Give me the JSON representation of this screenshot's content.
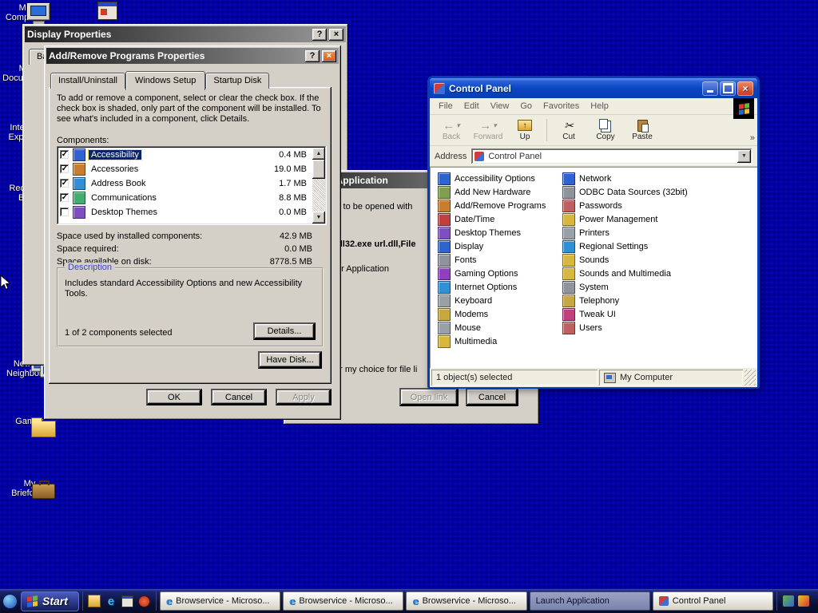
{
  "colors": {
    "desktop": "#0000a4",
    "window_gray": "#d4d0c8",
    "classic_titlebar_start": "#232323",
    "classic_titlebar_end": "#9a9a9a",
    "xp_titlebar_blue": "#0a46c4",
    "close_button_orange": "#d4541c",
    "selection_navy": "#0a246a",
    "taskbar_navy": "#0c1238"
  },
  "desktop": {
    "icons": [
      {
        "label": "My Computer"
      },
      {
        "label": ""
      },
      {
        "label": "My Documents"
      },
      {
        "label": "Internet Explorer"
      },
      {
        "label": "Recycle Bin"
      },
      {
        "label": ""
      },
      {
        "label": ""
      },
      {
        "label": "Network Neighborhood"
      },
      {
        "label": "Games"
      },
      {
        "label": "My Briefcase"
      }
    ]
  },
  "display_properties": {
    "title": "Display Properties",
    "help_button": "?",
    "close_button": "×",
    "background_tab": "Background"
  },
  "add_remove": {
    "title": "Add/Remove Programs Properties",
    "help_button": "?",
    "close_button": "×",
    "tabs": [
      {
        "label": "Install/Uninstall"
      },
      {
        "label": "Windows Setup"
      },
      {
        "label": "Startup Disk"
      }
    ],
    "intro": "To add or remove a component, select or clear the check box. If the check box is shaded, only part of the component will be installed. To see what's included in a component, click Details.",
    "components_label": "Components:",
    "components": [
      {
        "name": "Accessibility",
        "size": "0.4 MB",
        "color": "#2f63cf"
      },
      {
        "name": "Accessories",
        "size": "19.0 MB",
        "color": "#c77f2f"
      },
      {
        "name": "Address Book",
        "size": "1.7 MB",
        "color": "#2f8fd7"
      },
      {
        "name": "Communications",
        "size": "8.8 MB",
        "color": "#3fae6f"
      },
      {
        "name": "Desktop Themes",
        "size": "0.0 MB",
        "color": "#7f4fc2"
      }
    ],
    "space": [
      {
        "label": "Space used by installed components:",
        "value": "42.9 MB"
      },
      {
        "label": "Space required:",
        "value": "0.0 MB"
      },
      {
        "label": "Space available on disk:",
        "value": "8778.5 MB"
      }
    ],
    "description_title": "Description",
    "description_text": "Includes standard Accessibility Options and new Accessibility Tools.",
    "selection_summary": "1 of 2 components selected",
    "details_button": "Details...",
    "have_disk_button": "Have Disk...",
    "ok_button": "OK",
    "cancel_button": "Cancel",
    "apply_button": "Apply"
  },
  "launch_dialog": {
    "title": "Launch Application",
    "fragment_line1": "s to be opened with",
    "fragment_command": "dll32.exe url.dll,File",
    "fragment_line2": "er Application",
    "fragment_line3": "er my choice for file li",
    "open_link_button": "Open link",
    "cancel_button": "Cancel"
  },
  "control_panel": {
    "title": "Control Panel",
    "menu": [
      {
        "label": "File"
      },
      {
        "label": "Edit"
      },
      {
        "label": "View"
      },
      {
        "label": "Go"
      },
      {
        "label": "Favorites"
      },
      {
        "label": "Help"
      }
    ],
    "toolbar": [
      {
        "label": "Back"
      },
      {
        "label": "Forward"
      },
      {
        "label": "Up"
      },
      {
        "label": "Cut"
      },
      {
        "label": "Copy"
      },
      {
        "label": "Paste"
      }
    ],
    "address_label": "Address",
    "address_value": "Control Panel",
    "items_col1": [
      {
        "label": "Accessibility Options",
        "color": "#2f63cf"
      },
      {
        "label": "Add New Hardware",
        "color": "#7f9f4f"
      },
      {
        "label": "Add/Remove Programs",
        "color": "#c77f2f"
      },
      {
        "label": "Date/Time",
        "color": "#c23f3f"
      },
      {
        "label": "Desktop Themes",
        "color": "#7f4fc2"
      },
      {
        "label": "Display",
        "color": "#2f63cf"
      },
      {
        "label": "Fonts",
        "color": "#8f939b"
      },
      {
        "label": "Gaming Options",
        "color": "#8f3fbf"
      },
      {
        "label": "Internet Options",
        "color": "#2f8fd7"
      },
      {
        "label": "Keyboard",
        "color": "#9aa0a8"
      },
      {
        "label": "Modems",
        "color": "#c7a73f"
      },
      {
        "label": "Mouse",
        "color": "#9aa0a8"
      },
      {
        "label": "Multimedia",
        "color": "#d7b73f"
      }
    ],
    "items_col2": [
      {
        "label": "Network",
        "color": "#2f63cf"
      },
      {
        "label": "ODBC Data Sources (32bit)",
        "color": "#8f939b"
      },
      {
        "label": "Passwords",
        "color": "#bf5f5f"
      },
      {
        "label": "Power Management",
        "color": "#d7b73f"
      },
      {
        "label": "Printers",
        "color": "#9aa0a8"
      },
      {
        "label": "Regional Settings",
        "color": "#2f8fd7"
      },
      {
        "label": "Sounds",
        "color": "#d7b73f"
      },
      {
        "label": "Sounds and Multimedia",
        "color": "#d7b73f"
      },
      {
        "label": "System",
        "color": "#8f939b"
      },
      {
        "label": "Telephony",
        "color": "#c7a73f"
      },
      {
        "label": "Tweak UI",
        "color": "#bf3f7f"
      },
      {
        "label": "Users",
        "color": "#bf5f5f"
      }
    ],
    "status_left": "1 object(s) selected",
    "status_right": "My Computer"
  },
  "taskbar": {
    "start_label": "Start",
    "tasks": [
      {
        "label": "Browservice - Microso..."
      },
      {
        "label": "Browservice - Microso..."
      },
      {
        "label": "Browservice - Microso..."
      },
      {
        "label": "Launch Application"
      },
      {
        "label": "Control Panel"
      }
    ]
  }
}
